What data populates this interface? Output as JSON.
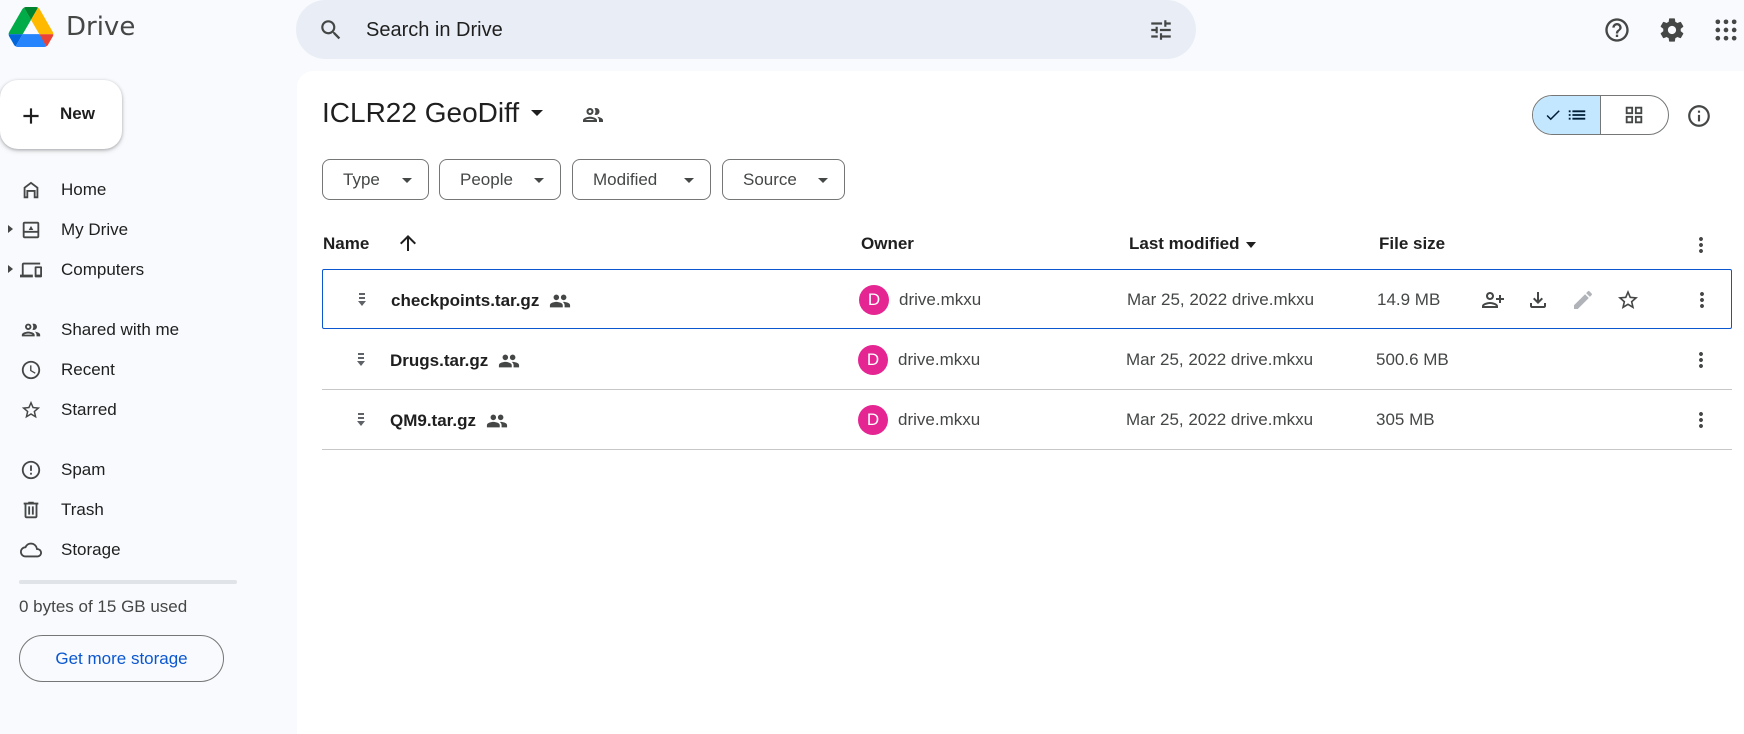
{
  "app": {
    "name": "Drive"
  },
  "search": {
    "placeholder": "Search in Drive"
  },
  "sidebar": {
    "new_label": "New",
    "items": [
      {
        "label": "Home"
      },
      {
        "label": "My Drive"
      },
      {
        "label": "Computers"
      },
      {
        "label": "Shared with me"
      },
      {
        "label": "Recent"
      },
      {
        "label": "Starred"
      },
      {
        "label": "Spam"
      },
      {
        "label": "Trash"
      },
      {
        "label": "Storage"
      }
    ],
    "storage_text": "0 bytes of 15 GB used",
    "storage_used_fraction": 0,
    "get_storage_label": "Get more storage"
  },
  "main": {
    "folder_title": "ICLR22 GeoDiff",
    "filters": [
      "Type",
      "People",
      "Modified",
      "Source"
    ],
    "columns": {
      "name": "Name",
      "owner": "Owner",
      "modified": "Last modified",
      "size": "File size"
    },
    "files": [
      {
        "name": "checkpoints.tar.gz",
        "owner_initial": "D",
        "owner": "drive.mkxu",
        "modified": "Mar 25, 2022 drive.mkxu",
        "size": "14.9 MB",
        "selected": true
      },
      {
        "name": "Drugs.tar.gz",
        "owner_initial": "D",
        "owner": "drive.mkxu",
        "modified": "Mar 25, 2022 drive.mkxu",
        "size": "500.6 MB",
        "selected": false
      },
      {
        "name": "QM9.tar.gz",
        "owner_initial": "D",
        "owner": "drive.mkxu",
        "modified": "Mar 25, 2022 drive.mkxu",
        "size": "305 MB",
        "selected": false
      }
    ]
  },
  "colors": {
    "accent": "#0b57d0",
    "toggle_selected": "#c2e7ff",
    "avatar": "#e52592",
    "search_bg": "#e9eef6",
    "page_bg": "#f8fafd"
  }
}
